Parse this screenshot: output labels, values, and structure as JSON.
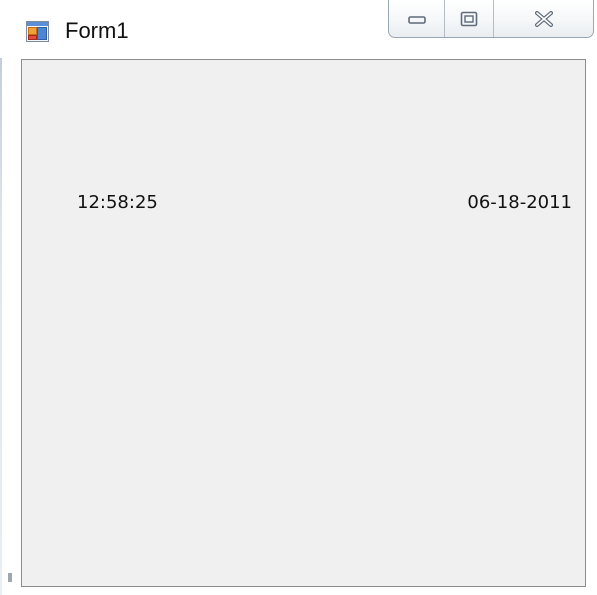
{
  "window": {
    "title": "Form1",
    "icon": "form-app-icon"
  },
  "caption_buttons": [
    {
      "name": "minimize",
      "icon": "minimize-icon"
    },
    {
      "name": "maximize",
      "icon": "maximize-icon"
    },
    {
      "name": "close",
      "icon": "close-icon"
    }
  ],
  "form": {
    "time_label": "12:58:25",
    "date_label": "06-18-2011",
    "background": "#f0f0f0",
    "border": "#8c8c8c"
  },
  "colors": {
    "caption_border": "#9aa6b3",
    "glyph": "#5d6b7a"
  }
}
